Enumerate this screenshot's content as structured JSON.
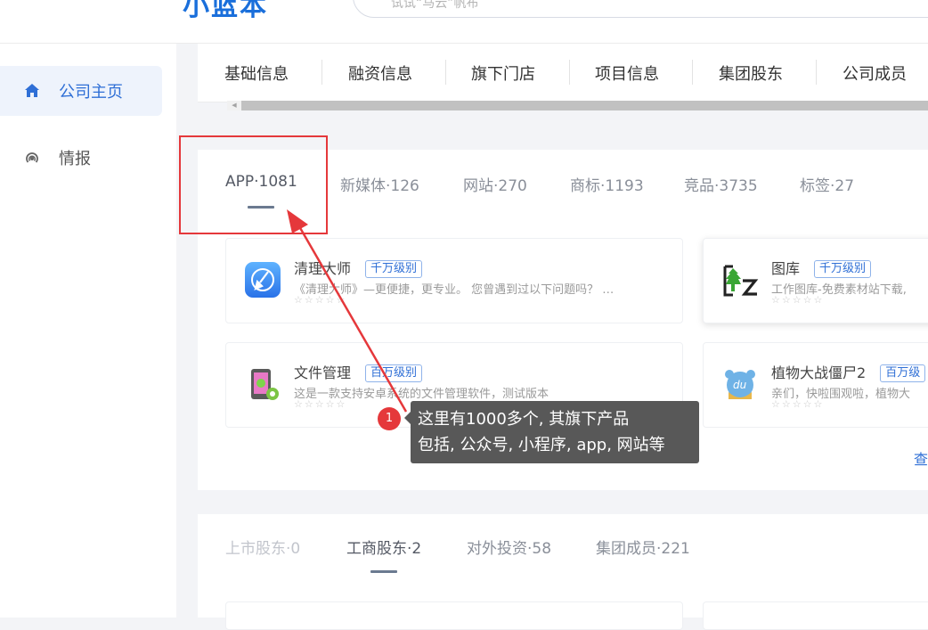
{
  "header": {
    "logo_text": "小蓝本",
    "search_placeholder": "试试“马云”帆布"
  },
  "sidebar": {
    "items": [
      {
        "label": "公司主页",
        "icon": "home-icon",
        "active": true
      },
      {
        "label": "情报",
        "icon": "radar-icon",
        "active": false
      }
    ]
  },
  "nav": {
    "tabs": [
      {
        "label": "基础信息"
      },
      {
        "label": "融资信息"
      },
      {
        "label": "旗下门店"
      },
      {
        "label": "项目信息"
      },
      {
        "label": "集团股东"
      },
      {
        "label": "公司成员"
      }
    ]
  },
  "products": {
    "tabs": [
      {
        "label": "APP·1081",
        "active": true
      },
      {
        "label": "新媒体·126"
      },
      {
        "label": "网站·270"
      },
      {
        "label": "商标·1193"
      },
      {
        "label": "竞品·3735"
      },
      {
        "label": "标签·27"
      }
    ],
    "cards": [
      {
        "name": "清理大师",
        "badge": "千万级别",
        "desc": "《清理大师》—更便捷，更专业。 您曾遇到过以下问题吗？ …",
        "stars": "☆☆☆☆☆",
        "icon": "broom-app-icon"
      },
      {
        "name": "图库",
        "badge": "千万级别",
        "desc": "工作图库-免费素材站下载,",
        "stars": "☆☆☆☆☆",
        "icon": "gallery-app-icon"
      },
      {
        "name": "文件管理",
        "badge": "百万级别",
        "desc": "这是一款支持安卓系统的文件管理软件，测试版本",
        "stars": "☆☆☆☆☆",
        "icon": "file-manager-app-icon"
      },
      {
        "name": "植物大战僵尸2",
        "badge": "百万级",
        "desc": "亲们，快啦围观啦，植物大",
        "stars": "☆☆☆☆☆",
        "icon": "game-app-icon"
      }
    ],
    "view_more": "查"
  },
  "shareholders": {
    "tabs": [
      {
        "label": "上市股东·0",
        "disabled": true
      },
      {
        "label": "工商股东·2",
        "active": true
      },
      {
        "label": "对外投资·58"
      },
      {
        "label": "集团成员·221"
      }
    ]
  },
  "annotation": {
    "step": "1",
    "lines": [
      "这里有1000多个, 其旗下产品",
      "包括, 公众号, 小程序, app, 网站等"
    ],
    "color": "#e5383b"
  }
}
